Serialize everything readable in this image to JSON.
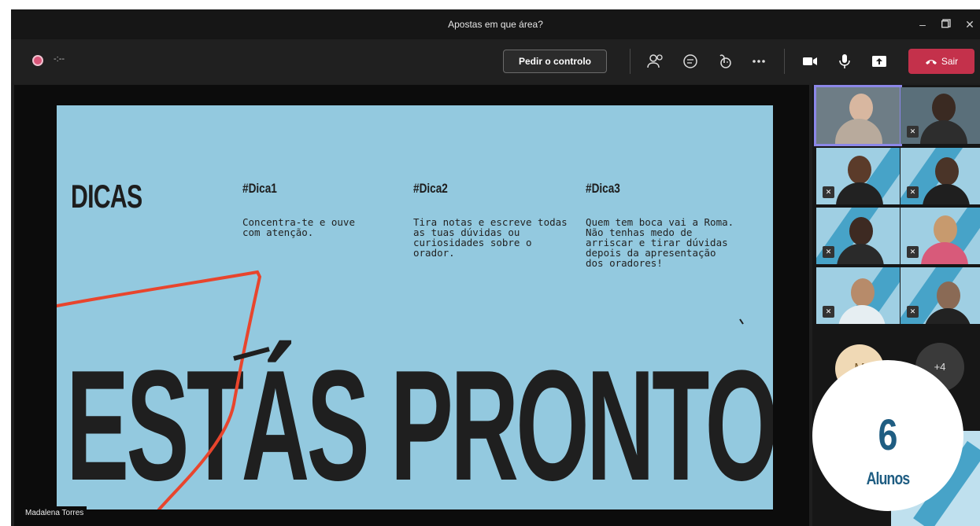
{
  "window": {
    "title": "Apostas em que área?"
  },
  "toolbar": {
    "timer": "-:--",
    "control_label": "Pedir o controlo",
    "leave_label": "Sair"
  },
  "slide": {
    "heading": "DICAS",
    "tips": [
      {
        "title": "#Dica1",
        "text": "Concentra-te e ouve com atenção."
      },
      {
        "title": "#Dica2",
        "text": "Tira notas e escreve todas as tuas dúvidas ou curiosidades sobre o orador."
      },
      {
        "title": "#Dica3",
        "text": "Quem tem boca vai a Roma. Não tenhas medo de arriscar e tirar dúvidas depois da apresentação dos oradores!"
      }
    ],
    "big_text": "ESTÁS PRONTO?"
  },
  "presenter": {
    "name": "Madalena Torres"
  },
  "participants": {
    "avatar_initials": "M",
    "overflow_count": "+4"
  },
  "badge": {
    "count": "6",
    "label": "Alunos"
  },
  "colors": {
    "leave": "#c4314b",
    "slide_bg": "#93c9df",
    "badge_text": "#1f5d82",
    "ink": "#e8452d"
  }
}
